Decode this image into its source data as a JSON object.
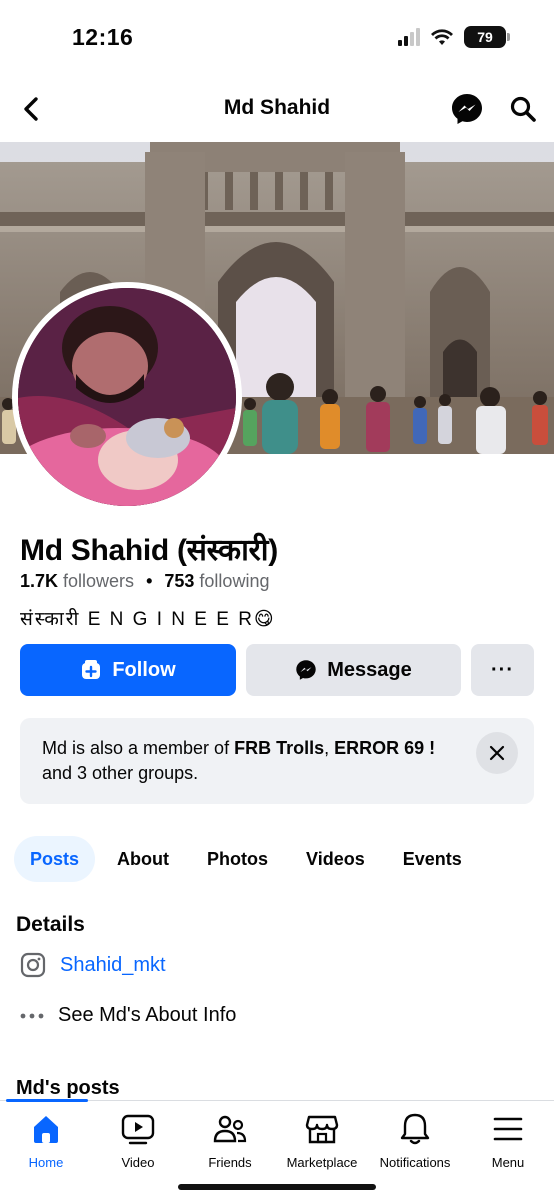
{
  "status_bar": {
    "time": "12:16",
    "battery": "79"
  },
  "header": {
    "title": "Md Shahid"
  },
  "profile": {
    "name": "Md Shahid (संस्कारी)",
    "followers_count": "1.7K",
    "followers_label": "followers",
    "following_count": "753",
    "following_label": "following",
    "bio": "संस्कारी E N G I N E E R😋"
  },
  "actions": {
    "follow": "Follow",
    "message": "Message",
    "more": "···"
  },
  "groups": {
    "prefix": "Md is also a member of ",
    "group1": "FRB Trolls",
    "sep": ", ",
    "group2": "ERROR 69 !",
    "suffix": " and 3 other groups."
  },
  "tabs": [
    "Posts",
    "About",
    "Photos",
    "Videos",
    "Events"
  ],
  "details": {
    "title": "Details",
    "instagram": "Shahid_mkt",
    "about_info": "See Md's About Info"
  },
  "posts_title": "Md's posts",
  "bottom_nav": [
    "Home",
    "Video",
    "Friends",
    "Marketplace",
    "Notifications",
    "Menu"
  ],
  "colors": {
    "accent": "#0866ff",
    "button_gray": "#e4e6eb",
    "card_bg": "#f0f2f5"
  }
}
